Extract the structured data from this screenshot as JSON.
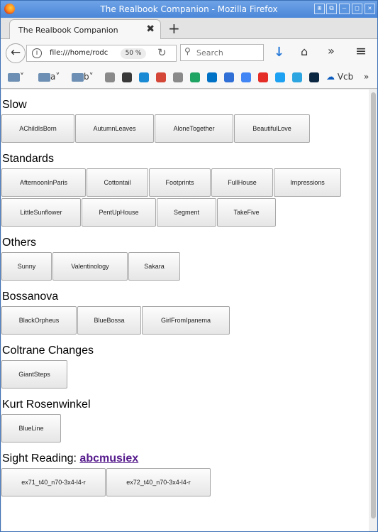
{
  "window": {
    "title": "The Realbook Companion - Mozilla Firefox",
    "controls": [
      "⊞",
      "⧉",
      "–",
      "□",
      "✕"
    ]
  },
  "tab": {
    "label": "The Realbook Companion",
    "close": "✖",
    "new_tab": "+"
  },
  "nav": {
    "back": "←",
    "info": "i",
    "url": "file:///home/rodc",
    "zoom": "50 %",
    "reload": "↻",
    "search_placeholder": "Search",
    "download": "↓",
    "home": "⌂",
    "overflow": "»",
    "menu": "≡"
  },
  "bookmarks": {
    "folders": [
      {
        "label": ""
      },
      {
        "label": "a"
      },
      {
        "label": "b"
      }
    ],
    "favicons": [
      {
        "name": "globe-icon",
        "color": "#8a8a8a"
      },
      {
        "name": "c-icon",
        "color": "#3a3a3a"
      },
      {
        "name": "sync-icon",
        "color": "#1a8ad4"
      },
      {
        "name": "gmail-icon",
        "color": "#d44638"
      },
      {
        "name": "globe-icon",
        "color": "#8a8a8a"
      },
      {
        "name": "drive-icon",
        "color": "#1fa463"
      },
      {
        "name": "outlook-icon",
        "color": "#0072c6"
      },
      {
        "name": "calendar-icon",
        "color": "#2f6fd6"
      },
      {
        "name": "translate-icon",
        "color": "#4285f4"
      },
      {
        "name": "youtube-icon",
        "color": "#e52d27"
      },
      {
        "name": "twitter-icon",
        "color": "#1da1f2"
      },
      {
        "name": "telegram-icon",
        "color": "#2ca5e0"
      },
      {
        "name": "x-app-icon",
        "color": "#0b2742"
      }
    ],
    "last_label": "Vcb",
    "overflow": "»"
  },
  "sections": [
    {
      "title": "Slow",
      "rows": [
        [
          "AChildIsBorn",
          "AutumnLeaves",
          "AloneTogether",
          "BeautifulLove"
        ]
      ]
    },
    {
      "title": "Standards",
      "rows": [
        [
          "AfternoonInParis",
          "Cottontail",
          "Footprints",
          "FullHouse",
          "Impressions"
        ],
        [
          "LittleSunflower",
          "PentUpHouse",
          "Segment",
          "TakeFive"
        ]
      ]
    },
    {
      "title": "Others",
      "rows": [
        [
          "Sunny",
          "Valentinology",
          "Sakara"
        ]
      ]
    },
    {
      "title": "Bossanova",
      "rows": [
        [
          "BlackOrpheus",
          "BlueBossa",
          "GirlFromIpanema"
        ]
      ]
    },
    {
      "title": "Coltrane Changes",
      "rows": [
        [
          "GiantSteps"
        ]
      ]
    },
    {
      "title": "Kurt Rosenwinkel",
      "rows": [
        [
          "BlueLine"
        ]
      ]
    },
    {
      "title": "Sight Reading:",
      "link": "abcmusiex",
      "rows": [
        [
          "ex71_t40_n70-3x4-l4-r",
          "ex72_t40_n70-3x4-l4-r"
        ]
      ]
    }
  ]
}
